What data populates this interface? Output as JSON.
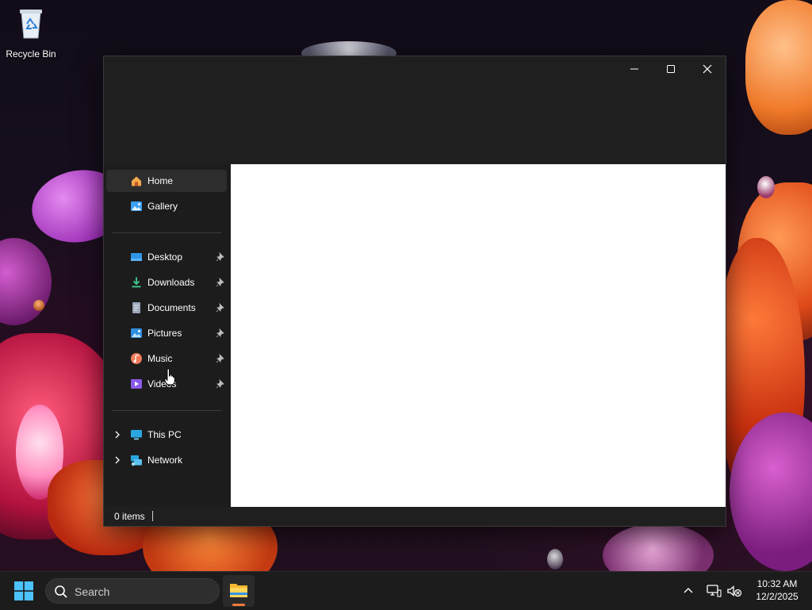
{
  "desktop": {
    "icons": [
      {
        "label": "Recycle Bin",
        "icon": "recycle-bin-icon"
      }
    ]
  },
  "window": {
    "controls": {
      "minimize": "minimize-icon",
      "maximize": "maximize-icon",
      "close": "close-icon"
    },
    "nav": {
      "quick": [
        {
          "label": "Home",
          "icon": "home-icon",
          "selected": true
        },
        {
          "label": "Gallery",
          "icon": "gallery-icon"
        }
      ],
      "pinned": [
        {
          "label": "Desktop",
          "icon": "desktop-folder-icon",
          "pinned": true
        },
        {
          "label": "Downloads",
          "icon": "downloads-icon",
          "pinned": true
        },
        {
          "label": "Documents",
          "icon": "documents-icon",
          "pinned": true
        },
        {
          "label": "Pictures",
          "icon": "pictures-icon",
          "pinned": true
        },
        {
          "label": "Music",
          "icon": "music-icon",
          "pinned": true
        },
        {
          "label": "Videos",
          "icon": "videos-icon",
          "pinned": true
        }
      ],
      "locations": [
        {
          "label": "This PC",
          "icon": "this-pc-icon",
          "expandable": true
        },
        {
          "label": "Network",
          "icon": "network-icon",
          "expandable": true
        }
      ]
    },
    "status": {
      "item_count": "0 items"
    }
  },
  "taskbar": {
    "search_label": "Search",
    "apps": [
      {
        "name": "File Explorer",
        "icon": "file-explorer-icon",
        "active": true
      }
    ],
    "tray": {
      "time": "10:32 AM",
      "date": "12/2/2025"
    }
  },
  "colors": {
    "accent": "#f07a3a",
    "window_bg": "#1f1f1f",
    "nav_selected": "#2d2d2d"
  }
}
